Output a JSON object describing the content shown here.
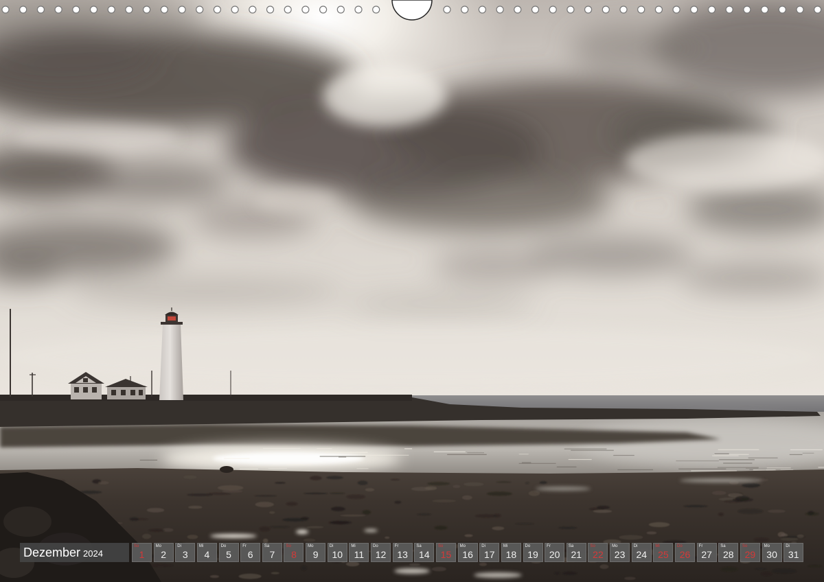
{
  "calendar": {
    "month": "Dezember",
    "year": "2024",
    "days": [
      {
        "weekday": "So",
        "number": 1,
        "highlight": true
      },
      {
        "weekday": "Mo",
        "number": 2,
        "highlight": false
      },
      {
        "weekday": "Di",
        "number": 3,
        "highlight": false
      },
      {
        "weekday": "Mi",
        "number": 4,
        "highlight": false
      },
      {
        "weekday": "Do",
        "number": 5,
        "highlight": false
      },
      {
        "weekday": "Fr",
        "number": 6,
        "highlight": false
      },
      {
        "weekday": "Sa",
        "number": 7,
        "highlight": false
      },
      {
        "weekday": "So",
        "number": 8,
        "highlight": true
      },
      {
        "weekday": "Mo",
        "number": 9,
        "highlight": false
      },
      {
        "weekday": "Di",
        "number": 10,
        "highlight": false
      },
      {
        "weekday": "Mi",
        "number": 11,
        "highlight": false
      },
      {
        "weekday": "Do",
        "number": 12,
        "highlight": false
      },
      {
        "weekday": "Fr",
        "number": 13,
        "highlight": false
      },
      {
        "weekday": "Sa",
        "number": 14,
        "highlight": false
      },
      {
        "weekday": "So",
        "number": 15,
        "highlight": true
      },
      {
        "weekday": "Mo",
        "number": 16,
        "highlight": false
      },
      {
        "weekday": "Di",
        "number": 17,
        "highlight": false
      },
      {
        "weekday": "Mi",
        "number": 18,
        "highlight": false
      },
      {
        "weekday": "Do",
        "number": 19,
        "highlight": false
      },
      {
        "weekday": "Fr",
        "number": 20,
        "highlight": false
      },
      {
        "weekday": "Sa",
        "number": 21,
        "highlight": false
      },
      {
        "weekday": "So",
        "number": 22,
        "highlight": true
      },
      {
        "weekday": "Mo",
        "number": 23,
        "highlight": false
      },
      {
        "weekday": "Di",
        "number": 24,
        "highlight": false
      },
      {
        "weekday": "Mi",
        "number": 25,
        "highlight": true
      },
      {
        "weekday": "Do",
        "number": 26,
        "highlight": true
      },
      {
        "weekday": "Fr",
        "number": 27,
        "highlight": false
      },
      {
        "weekday": "Sa",
        "number": 28,
        "highlight": false
      },
      {
        "weekday": "So",
        "number": 29,
        "highlight": true
      },
      {
        "weekday": "Mo",
        "number": 30,
        "highlight": false
      },
      {
        "weekday": "Di",
        "number": 31,
        "highlight": false
      }
    ]
  },
  "colors": {
    "highlight": "#e23b3b",
    "cell_background": "#5c5c5c",
    "text": "#ffffff"
  }
}
